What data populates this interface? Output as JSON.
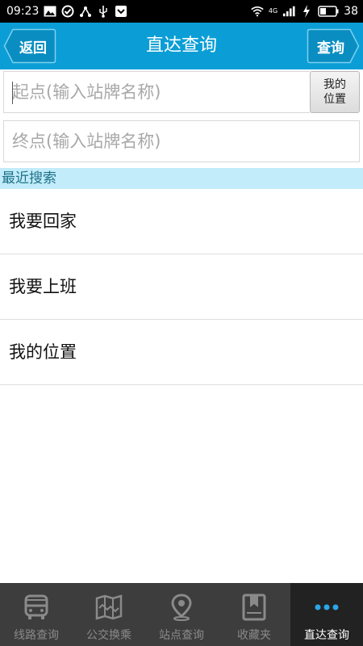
{
  "status_bar": {
    "time": "09:23",
    "network": "4G",
    "battery": "38"
  },
  "header": {
    "title": "直达查询",
    "back_label": "返回",
    "query_label": "查询"
  },
  "form": {
    "start_placeholder": "起点(输入站牌名称)",
    "end_placeholder": "终点(输入站牌名称)",
    "my_location_line1": "我的",
    "my_location_line2": "位置"
  },
  "recent": {
    "header": "最近搜索",
    "items": [
      "我要回家",
      "我要上班",
      "我的位置"
    ]
  },
  "tabs": [
    {
      "label": "线路查询",
      "icon": "bus-icon"
    },
    {
      "label": "公交换乘",
      "icon": "map-icon"
    },
    {
      "label": "站点查询",
      "icon": "location-pin-icon"
    },
    {
      "label": "收藏夹",
      "icon": "bookmark-icon"
    },
    {
      "label": "直达查询",
      "icon": "more-dots-icon",
      "active": true
    }
  ],
  "colors": {
    "title_bar": "#0b9ed6",
    "recent_header_bg": "#c2ecfa",
    "tab_bar": "#3d3d3d",
    "tab_active": "#222222"
  }
}
